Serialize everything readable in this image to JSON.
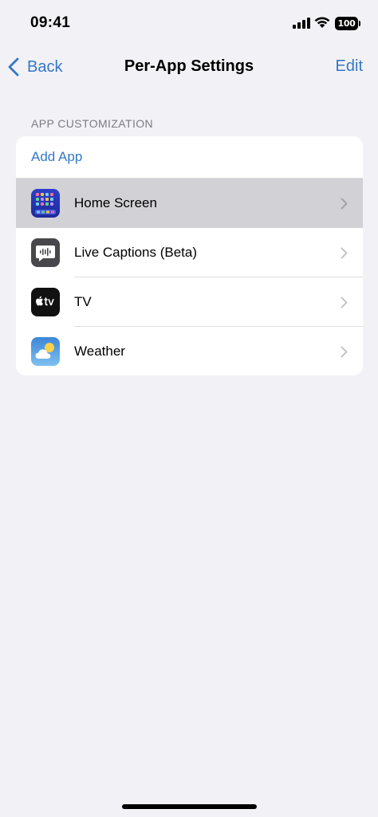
{
  "status_bar": {
    "time": "09:41",
    "battery": "100"
  },
  "nav": {
    "back_label": "Back",
    "title": "Per-App Settings",
    "edit_label": "Edit"
  },
  "section": {
    "header": "APP CUSTOMIZATION",
    "add_app_label": "Add App",
    "apps": [
      {
        "label": "Home Screen",
        "icon": "home-screen-icon",
        "highlighted": true
      },
      {
        "label": "Live Captions (Beta)",
        "icon": "live-captions-icon",
        "highlighted": false
      },
      {
        "label": "TV",
        "icon": "apple-tv-icon",
        "highlighted": false
      },
      {
        "label": "Weather",
        "icon": "weather-icon",
        "highlighted": false
      }
    ]
  },
  "colors": {
    "accent": "#3478c6",
    "background": "#f2f1f6",
    "highlight": "#d1d1d6"
  }
}
